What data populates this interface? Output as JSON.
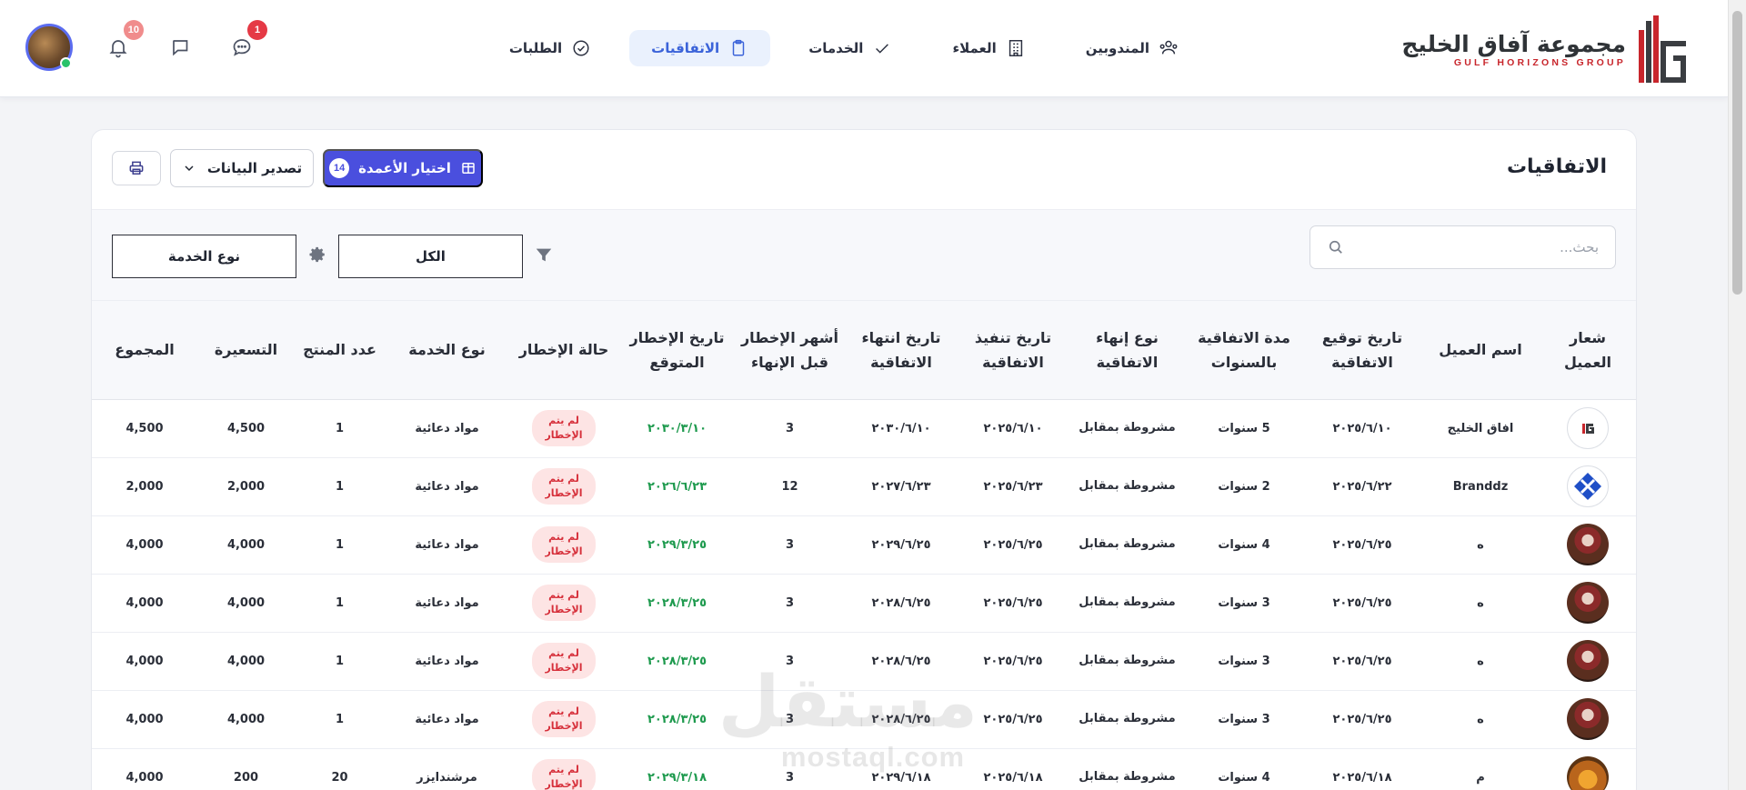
{
  "brand": {
    "name_ar": "مجموعة آفاق الخليج",
    "name_en": "GULF HORIZONS GROUP",
    "accent": "#c8262c"
  },
  "nav": [
    {
      "label": "المندوبين",
      "icon": "users-icon",
      "active": false
    },
    {
      "label": "العملاء",
      "icon": "building-icon",
      "active": false
    },
    {
      "label": "الخدمات",
      "icon": "check-icon",
      "active": false
    },
    {
      "label": "الاتفاقيات",
      "icon": "clipboard-icon",
      "active": true
    },
    {
      "label": "الطلبات",
      "icon": "check-circle-icon",
      "active": false
    }
  ],
  "notifications": {
    "chat_badge": "1",
    "bell_badge": "10"
  },
  "page": {
    "title": "الاتفاقيات",
    "columns_button": "اختيار الأعمدة",
    "columns_count": "14",
    "export_button": "تصدير البيانات",
    "search_placeholder": "بحث...",
    "filter_value": "الكل",
    "filter_field": "نوع الخدمة"
  },
  "table": {
    "headers": [
      "شعار العميل",
      "اسم العميل",
      "تاريخ توقيع الاتفاقية",
      "مدة الاتفاقية بالسنوات",
      "نوع إنهاء الاتفاقية",
      "تاريخ تنفيذ الاتفاقية",
      "تاريخ انتهاء الاتفاقية",
      "أشهر الإخطار قبل الإنهاء",
      "تاريخ الإخطار المتوقع",
      "حالة الإخطار",
      "نوع الخدمة",
      "عدد المنتج",
      "التسعيرة",
      "المجموع"
    ],
    "rows": [
      {
        "logo": "gulf",
        "client": "افاق الخليج",
        "signed": "٢٠٢٥/٦/١٠",
        "duration": "5 سنوات",
        "termination": "مشروطة بمقابل",
        "start": "٢٠٢٥/٦/١٠",
        "end": "٢٠٣٠/٦/١٠",
        "notice_months": "3",
        "notice_date": "٢٠٣٠/٣/١٠",
        "status": "لم يتم الإخطار",
        "service": "مواد دعائية",
        "qty": "1",
        "price": "4,500",
        "total": "4,500"
      },
      {
        "logo": "branddz",
        "client": "Branddz",
        "signed": "٢٠٢٥/٦/٢٢",
        "duration": "2 سنوات",
        "termination": "مشروطة بمقابل",
        "start": "٢٠٢٥/٦/٢٣",
        "end": "٢٠٢٧/٦/٢٣",
        "notice_months": "12",
        "notice_date": "٢٠٢٦/٦/٢٣",
        "status": "لم يتم الإخطار",
        "service": "مواد دعائية",
        "qty": "1",
        "price": "2,000",
        "total": "2,000"
      },
      {
        "logo": "photo",
        "client": "ه",
        "signed": "٢٠٢٥/٦/٢٥",
        "duration": "4 سنوات",
        "termination": "مشروطة بمقابل",
        "start": "٢٠٢٥/٦/٢٥",
        "end": "٢٠٢٩/٦/٢٥",
        "notice_months": "3",
        "notice_date": "٢٠٢٩/٣/٢٥",
        "status": "لم يتم الإخطار",
        "service": "مواد دعائية",
        "qty": "1",
        "price": "4,000",
        "total": "4,000"
      },
      {
        "logo": "photo",
        "client": "ه",
        "signed": "٢٠٢٥/٦/٢٥",
        "duration": "3 سنوات",
        "termination": "مشروطة بمقابل",
        "start": "٢٠٢٥/٦/٢٥",
        "end": "٢٠٢٨/٦/٢٥",
        "notice_months": "3",
        "notice_date": "٢٠٢٨/٣/٢٥",
        "status": "لم يتم الإخطار",
        "service": "مواد دعائية",
        "qty": "1",
        "price": "4,000",
        "total": "4,000"
      },
      {
        "logo": "photo",
        "client": "ه",
        "signed": "٢٠٢٥/٦/٢٥",
        "duration": "3 سنوات",
        "termination": "مشروطة بمقابل",
        "start": "٢٠٢٥/٦/٢٥",
        "end": "٢٠٢٨/٦/٢٥",
        "notice_months": "3",
        "notice_date": "٢٠٢٨/٣/٢٥",
        "status": "لم يتم الإخطار",
        "service": "مواد دعائية",
        "qty": "1",
        "price": "4,000",
        "total": "4,000"
      },
      {
        "logo": "photo",
        "client": "ه",
        "signed": "٢٠٢٥/٦/٢٥",
        "duration": "3 سنوات",
        "termination": "مشروطة بمقابل",
        "start": "٢٠٢٥/٦/٢٥",
        "end": "٢٠٢٨/٦/٢٥",
        "notice_months": "3",
        "notice_date": "٢٠٢٨/٣/٢٥",
        "status": "لم يتم الإخطار",
        "service": "مواد دعائية",
        "qty": "1",
        "price": "4,000",
        "total": "4,000"
      },
      {
        "logo": "crowd",
        "client": "م",
        "signed": "٢٠٢٥/٦/١٨",
        "duration": "4 سنوات",
        "termination": "مشروطة بمقابل",
        "start": "٢٠٢٥/٦/١٨",
        "end": "٢٠٢٩/٦/١٨",
        "notice_months": "3",
        "notice_date": "٢٠٢٩/٣/١٨",
        "status": "لم يتم الإخطار",
        "service": "مرشندايزر",
        "qty": "20",
        "price": "200",
        "total": "4,000"
      }
    ]
  },
  "watermark": {
    "ar": "مستقل",
    "en": "mostaql.com"
  }
}
